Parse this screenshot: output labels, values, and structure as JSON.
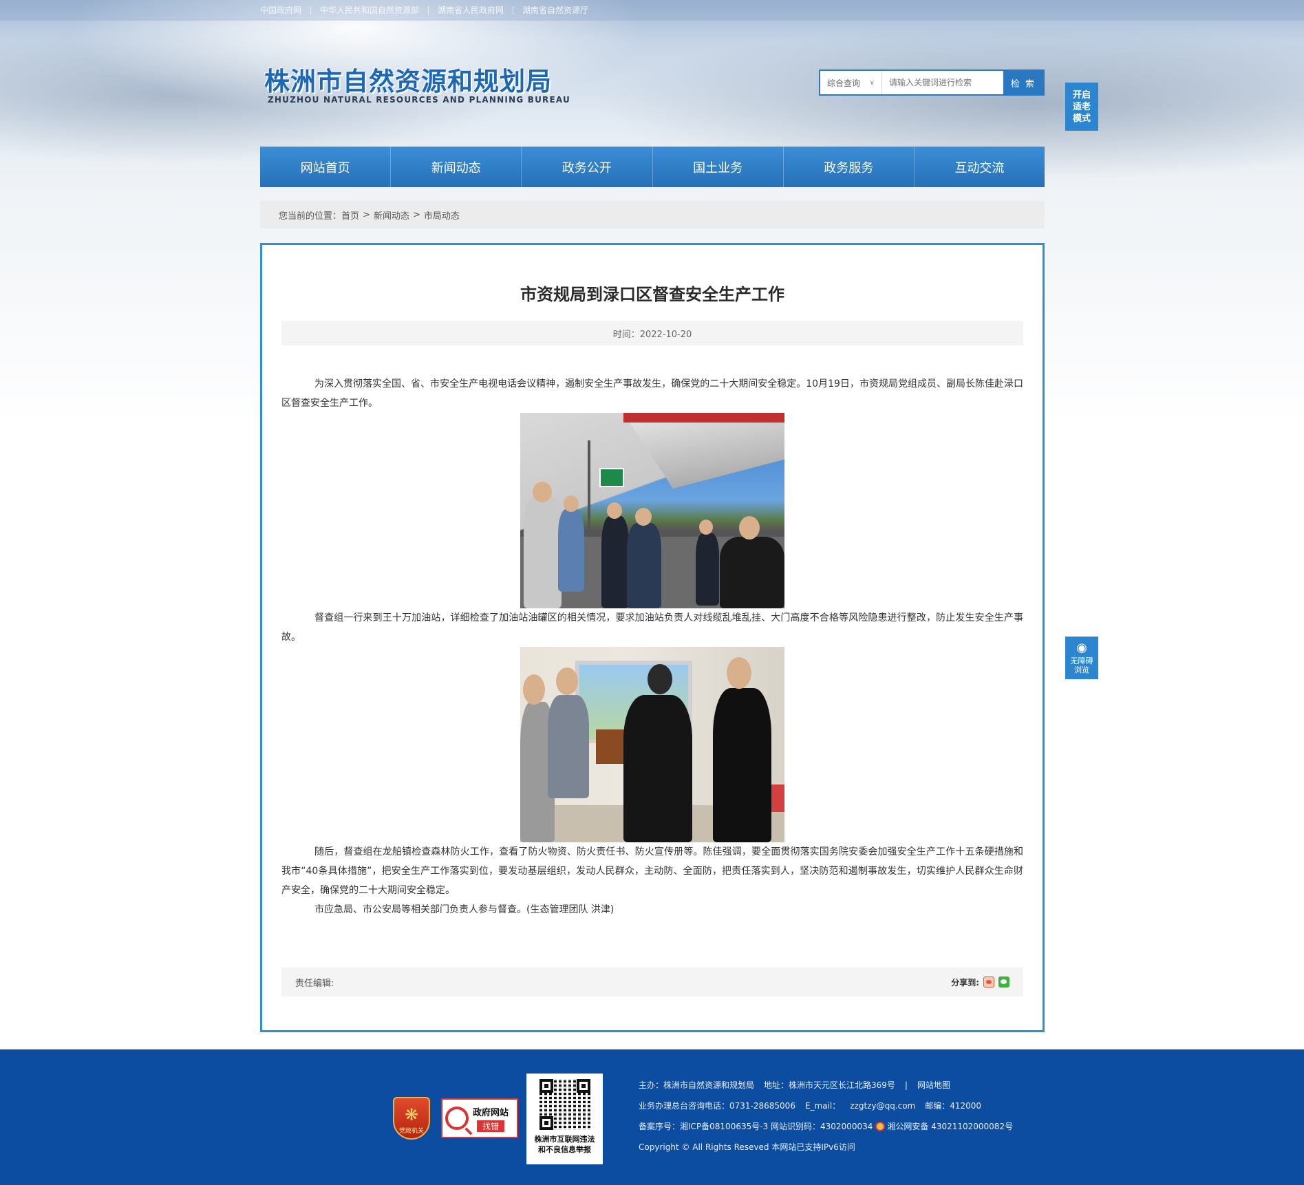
{
  "top_links": [
    "中国政府网",
    "中华人民共和国自然资源部",
    "湖南省人民政府网",
    "湖南省自然资源厅"
  ],
  "logo": {
    "cn": "株洲市自然资源和规划局",
    "en": "ZHUZHOU NATURAL RESOURCES AND PLANNING BUREAU"
  },
  "search": {
    "scope": "综合查询",
    "placeholder": "请输入关键词进行检索",
    "button": "检 索"
  },
  "side": {
    "elder_mode": [
      "开启",
      "适老",
      "模式"
    ],
    "accessibility": [
      "无障碍",
      "浏览"
    ]
  },
  "nav": [
    "网站首页",
    "新闻动态",
    "政务公开",
    "国土业务",
    "政务服务",
    "互动交流"
  ],
  "breadcrumb": {
    "label": "您当前的位置：",
    "items": [
      "首页",
      "新闻动态",
      "市局动态"
    ],
    "sep": ">"
  },
  "article": {
    "title": "市资规局到渌口区督查安全生产工作",
    "time": "时间：2022-10-20",
    "paragraphs": [
      "为深入贯彻落实全国、省、市安全生产电视电话会议精神，遏制安全生产事故发生，确保党的二十大期间安全稳定。10月19日，市资规局党组成员、副局长陈佳赴渌口区督查安全生产工作。",
      "督查组一行来到王十万加油站，详细检查了加油站油罐区的相关情况，要求加油站负责人对线缆乱堆乱挂、大门高度不合格等风险隐患进行整改，防止发生安全生产事故。",
      "随后，督查组在龙船镇检查森林防火工作，查看了防火物资、防火责任书、防火宣传册等。陈佳强调，要全面贯彻落实国务院安委会加强安全生产工作十五条硬措施和我市“40条具体措施”，把安全生产工作落实到位，要发动基层组织，发动人民群众，主动防、全面防，把责任落实到人，坚决防范和遏制事故发生，切实维护人民群众生命财产安全，确保党的二十大期间安全稳定。",
      "市应急局、市公安局等相关部门负责人参与督查。(生态管理团队 洪津)"
    ],
    "editor": "责任编辑:",
    "share": "分享到:"
  },
  "footer": {
    "party_badge": "党政机关",
    "gov_badge": [
      "政府网站",
      "找错"
    ],
    "qr_caption": [
      "株洲市互联网违法",
      "和不良信息举报"
    ],
    "line1": [
      "主办：株洲市自然资源和规划局",
      "地址：株洲市天元区长江北路369号",
      "|",
      "网站地图"
    ],
    "line2": [
      "业务办理总台咨询电话：0731-28685006",
      "E_mail：",
      "zzgtzy@qq.com",
      "邮编：412000"
    ],
    "line3": [
      "备案序号：湘ICP备08100635号-3 网站识别码：4302000034",
      "湘公网安备 43021102000082号"
    ],
    "line4": "Copyright © All Rights Reseved 本网站已支持IPv6访问"
  },
  "colors": {
    "brand_blue": "#2b78c2",
    "frame_blue": "#2b92cf",
    "footer_blue": "#0c4da2"
  }
}
